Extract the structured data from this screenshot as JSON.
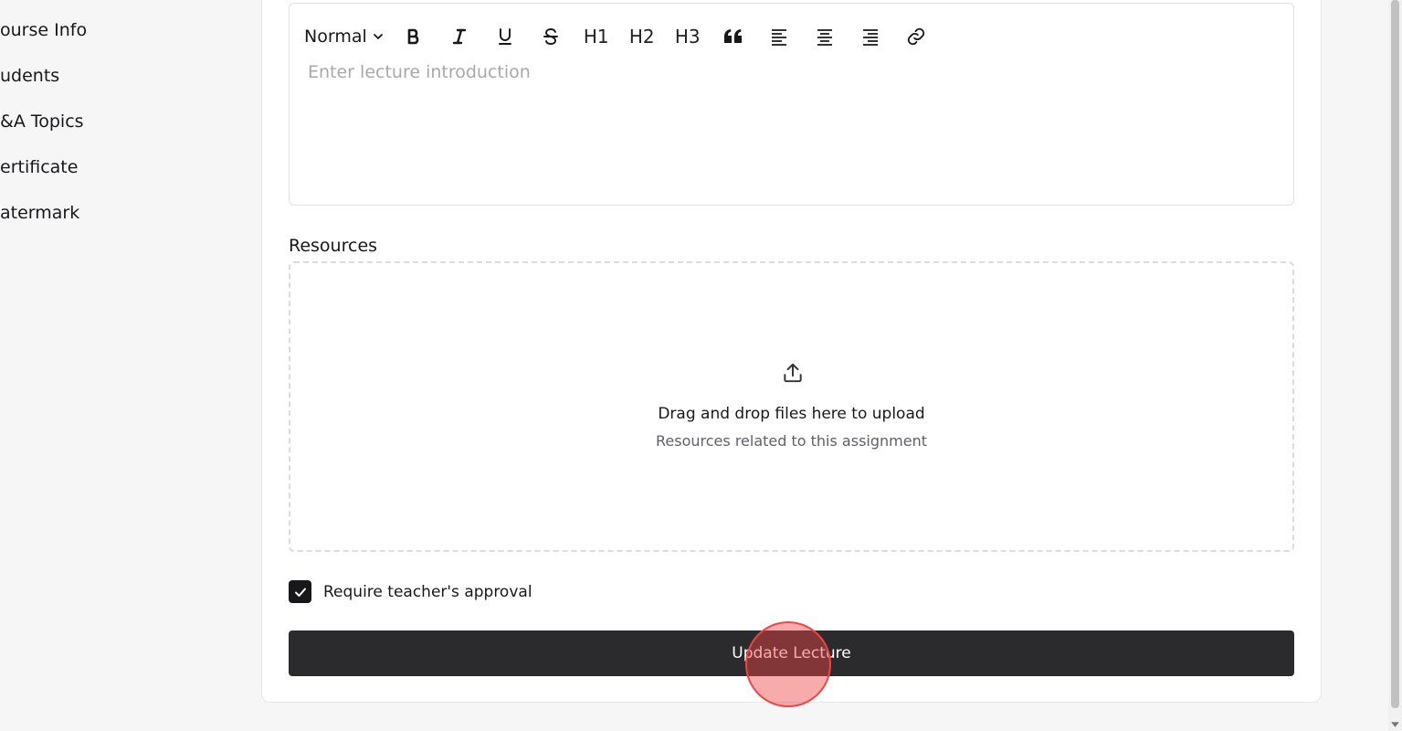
{
  "sidebar": {
    "items": [
      {
        "label": "ourse Info"
      },
      {
        "label": "udents"
      },
      {
        "label": "&A Topics"
      },
      {
        "label": "ertificate"
      },
      {
        "label": "atermark"
      }
    ]
  },
  "editor": {
    "format_select": "Normal",
    "toolbar": {
      "h1": "H1",
      "h2": "H2",
      "h3": "H3"
    },
    "placeholder": "Enter lecture introduction"
  },
  "resources": {
    "label": "Resources",
    "drop_title": "Drag and drop files here to upload",
    "drop_subtitle": "Resources related to this assignment"
  },
  "approval": {
    "label": "Require teacher's approval",
    "checked": true
  },
  "submit": {
    "label": "Update Lecture"
  },
  "colors": {
    "primary_button": "#2b2b2e",
    "click_marker": "#ef4444"
  }
}
